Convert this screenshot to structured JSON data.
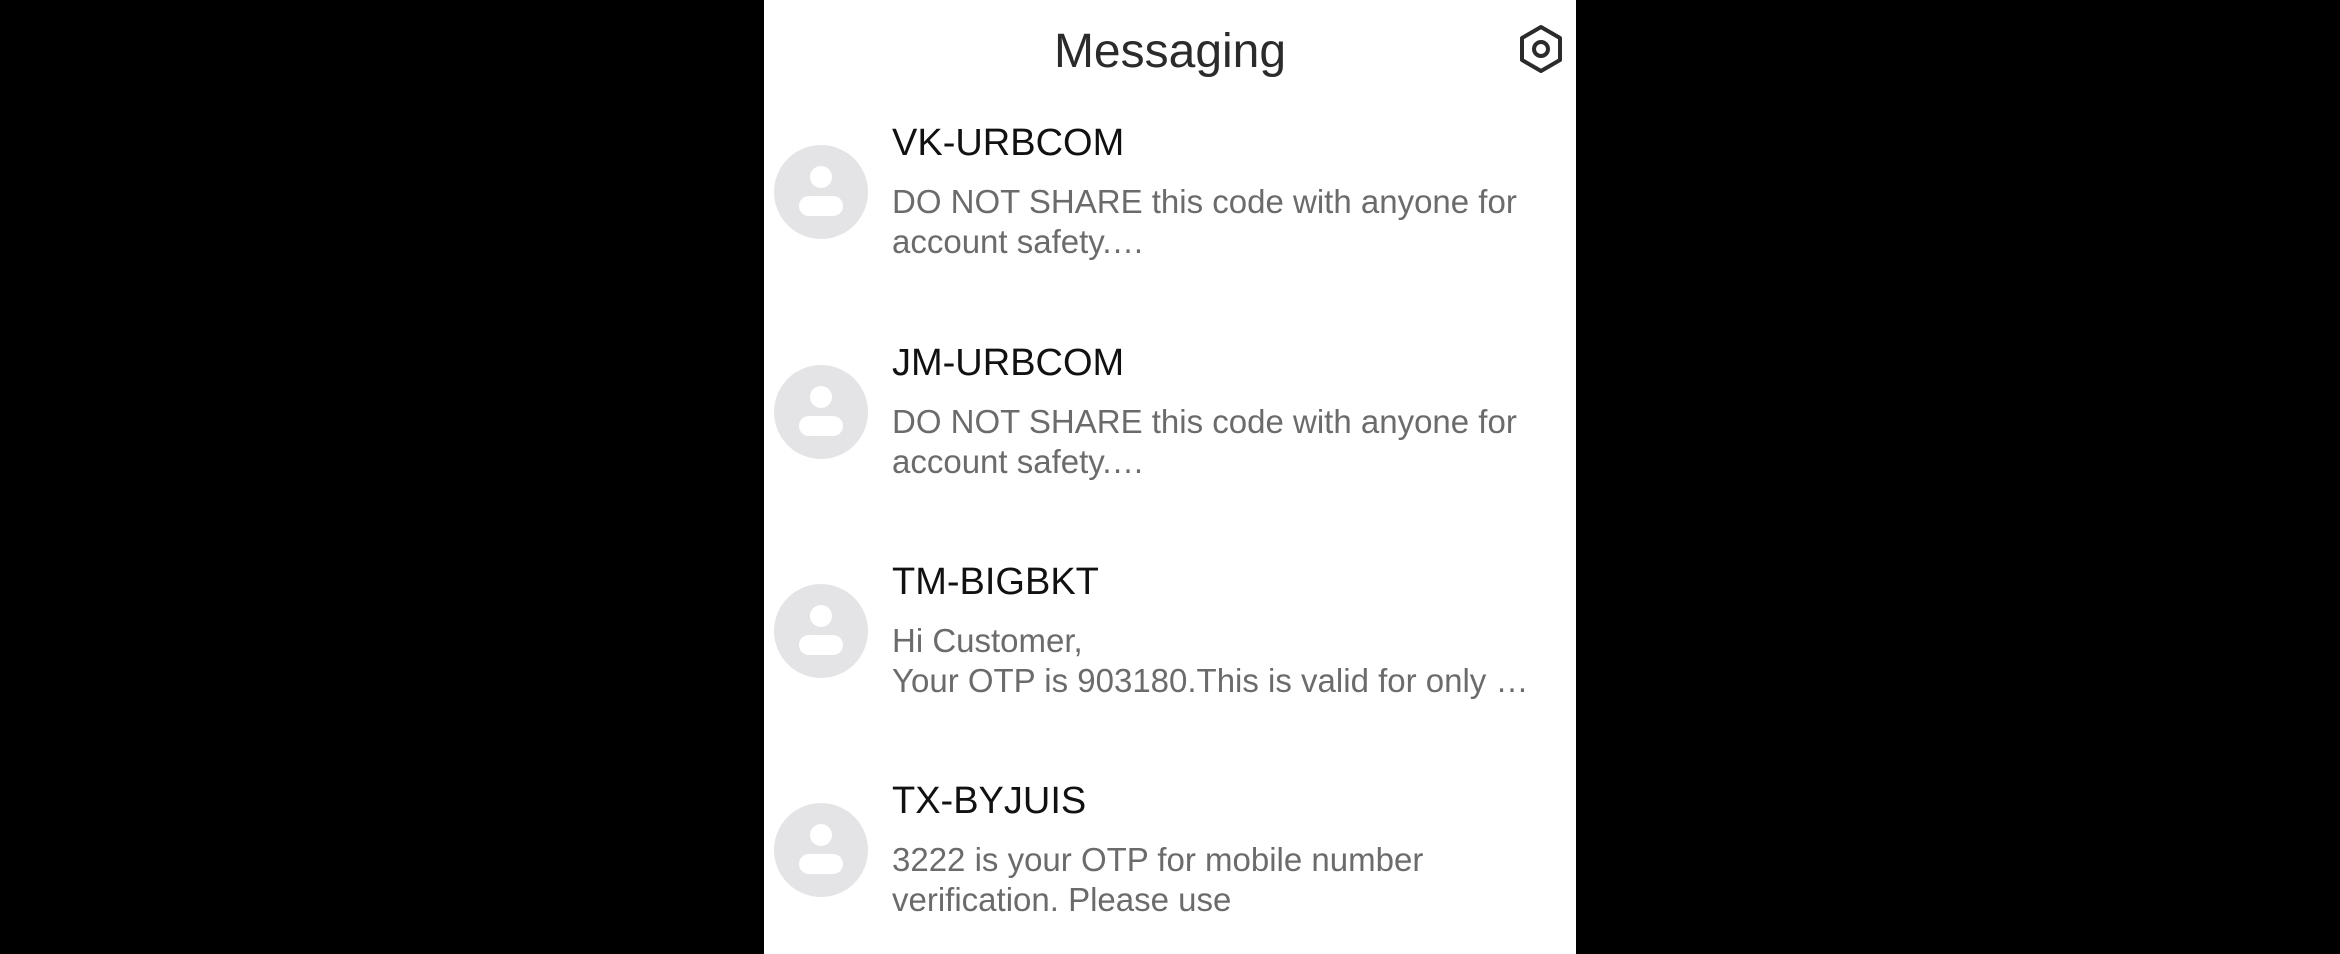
{
  "header": {
    "title": "Messaging",
    "settings_icon": "settings-hexagon-icon"
  },
  "threads": [
    {
      "sender": "VK-URBCOM",
      "snippet": "DO NOT SHARE this code with anyone for\naccount safety.…"
    },
    {
      "sender": "JM-URBCOM",
      "snippet": "DO NOT SHARE this code with anyone for\naccount safety.…"
    },
    {
      "sender": "TM-BIGBKT",
      "snippet": "Hi Customer,\nYour OTP is 903180.This is valid for only …"
    },
    {
      "sender": "TX-BYJUIS",
      "snippet": "3222 is your OTP for mobile number\nverification. Please use"
    }
  ],
  "colors": {
    "background_outside": "#000000",
    "screen_background": "#ffffff",
    "title_text": "#2b2b2b",
    "sender_text": "#111111",
    "snippet_text": "#6b6b6b",
    "avatar_background": "#e4e4e7"
  }
}
